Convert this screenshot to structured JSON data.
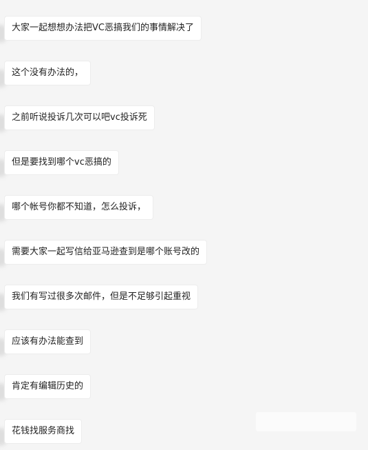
{
  "messages": [
    "大家一起想想办法把VC恶搞我们的事情解决了",
    "这个没有办法的，",
    "之前听说投诉几次可以吧vc投诉死",
    "但是要找到哪个vc恶搞的",
    "哪个帐号你都不知道，怎么投诉，",
    "需要大家一起写信给亚马逊查到是哪个账号改的",
    "我们有写过很多次邮件，但是不足够引起重视",
    "应该有办法能查到",
    "肯定有编辑历史的",
    "花钱找服务商找"
  ],
  "colors": {
    "background": "#f5f5f5",
    "bubble": "#ffffff",
    "text": "#222222"
  }
}
